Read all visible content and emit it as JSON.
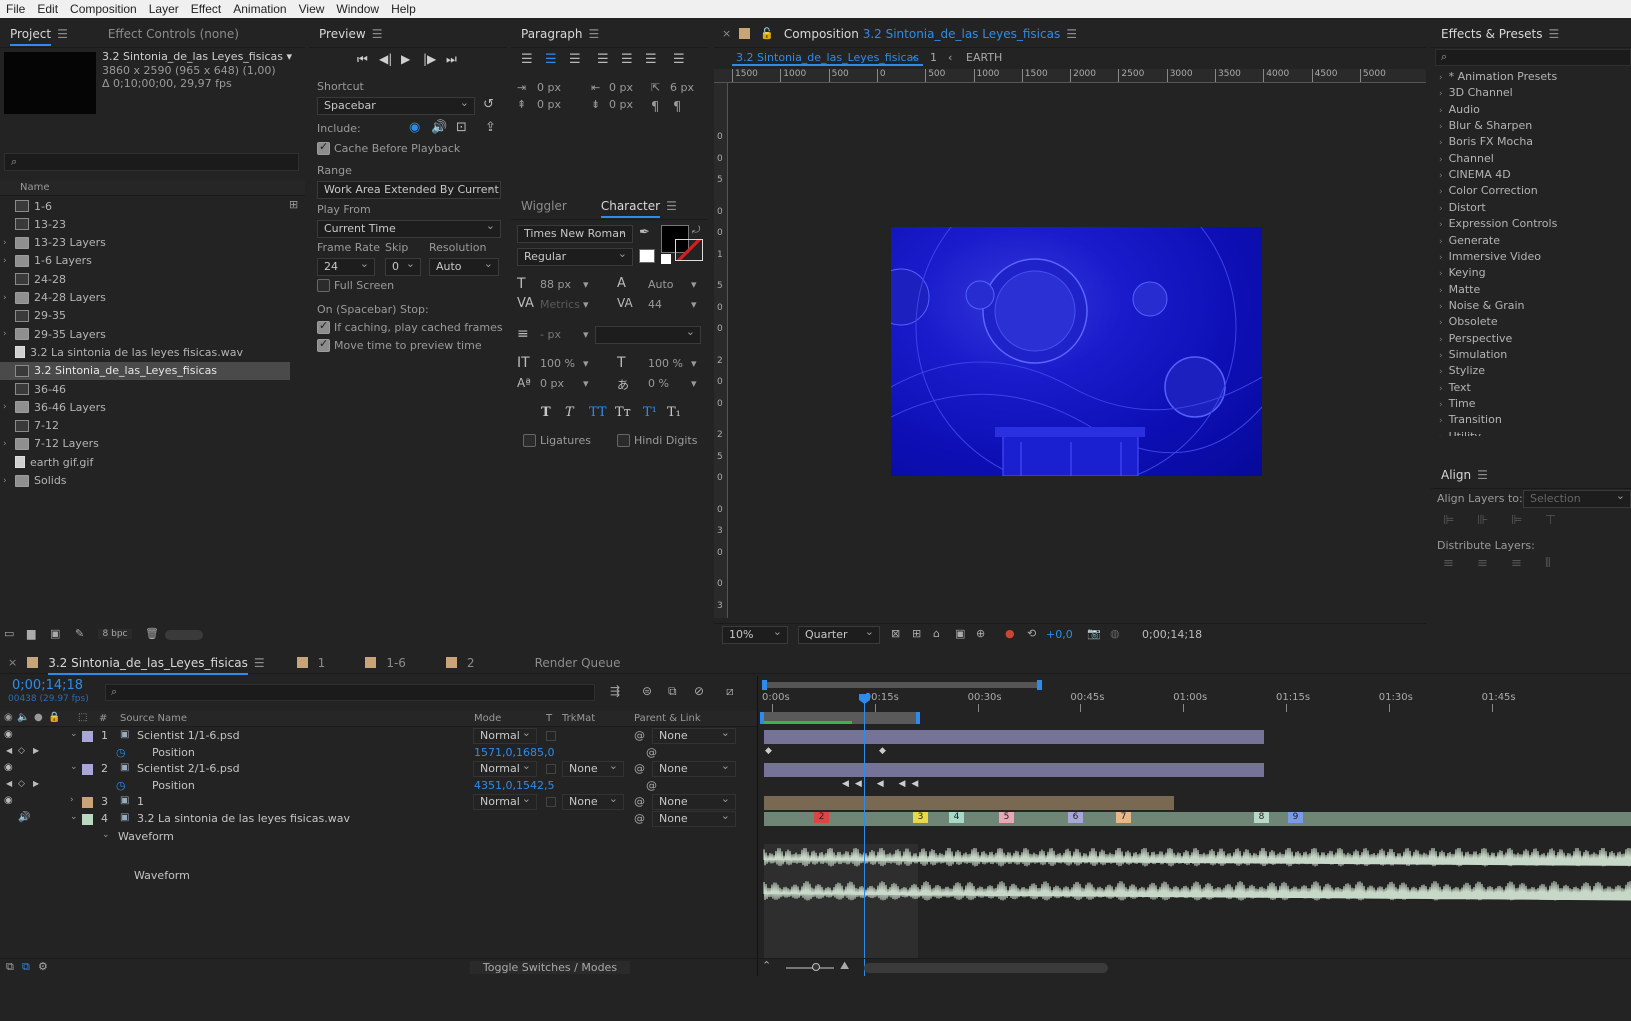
{
  "menu": [
    "File",
    "Edit",
    "Composition",
    "Layer",
    "Effect",
    "Animation",
    "View",
    "Window",
    "Help"
  ],
  "project": {
    "tab_label": "Project",
    "effect_controls_tab": "Effect Controls (none)",
    "selected_name": "3.2 Sintonia_de_las Leyes_fisicas",
    "selected_dims": "3860 x 2590  (965 x 648) (1,00)",
    "selected_dur": "Δ 0;10;00;00, 29,97 fps",
    "col_name": "Name",
    "bpc": "8 bpc",
    "items": [
      {
        "name": "1-6",
        "type": "comp",
        "twirl": false
      },
      {
        "name": "13-23",
        "type": "comp",
        "twirl": false
      },
      {
        "name": "13-23 Layers",
        "type": "folder",
        "twirl": true
      },
      {
        "name": "1-6 Layers",
        "type": "folder",
        "twirl": true
      },
      {
        "name": "24-28",
        "type": "comp",
        "twirl": false
      },
      {
        "name": "24-28 Layers",
        "type": "folder",
        "twirl": true
      },
      {
        "name": "29-35",
        "type": "comp",
        "twirl": false
      },
      {
        "name": "29-35 Layers",
        "type": "folder",
        "twirl": true
      },
      {
        "name": "3.2 La sintonia de las leyes fisicas.wav",
        "type": "file",
        "twirl": false
      },
      {
        "name": "3.2 Sintonia_de_las_Leyes_fisicas",
        "type": "comp",
        "twirl": false,
        "selected": true
      },
      {
        "name": "36-46",
        "type": "comp",
        "twirl": false
      },
      {
        "name": "36-46 Layers",
        "type": "folder",
        "twirl": true
      },
      {
        "name": "7-12",
        "type": "comp",
        "twirl": false
      },
      {
        "name": "7-12 Layers",
        "type": "folder",
        "twirl": true
      },
      {
        "name": "earth gif.gif",
        "type": "file",
        "twirl": false
      },
      {
        "name": "Solids",
        "type": "folder",
        "twirl": true
      }
    ]
  },
  "preview": {
    "tab_label": "Preview",
    "shortcut_label": "Shortcut",
    "shortcut_value": "Spacebar",
    "include_label": "Include:",
    "cache_label": "Cache Before Playback",
    "range_label": "Range",
    "range_value": "Work Area Extended By Current...",
    "play_from_label": "Play From",
    "play_from_value": "Current Time",
    "frame_rate_label": "Frame Rate",
    "skip_label": "Skip",
    "resolution_label": "Resolution",
    "frame_rate_value": "24",
    "skip_value": "0",
    "resolution_value": "Auto",
    "full_screen_label": "Full Screen",
    "stop_label": "On (Spacebar) Stop:",
    "if_caching_label": "If caching, play cached frames",
    "move_time_label": "Move time to preview time"
  },
  "paragraph": {
    "tab_label": "Paragraph",
    "indent_values": [
      "0 px",
      "0 px",
      "6 px",
      "0 px",
      "0 px"
    ]
  },
  "character": {
    "wiggler_tab": "Wiggler",
    "tab_label": "Character",
    "font": "Times New Roman",
    "style": "Regular",
    "size": "88 px",
    "leading": "Auto",
    "kerning": "Metrics",
    "tracking": "44",
    "stroke": "- px",
    "vscale": "100 %",
    "hscale": "100 %",
    "baseline": "0 px",
    "tsume": "0 %",
    "ligatures_label": "Ligatures",
    "hindi_label": "Hindi Digits",
    "style_buttons": [
      "T",
      "T",
      "TT",
      "Tт",
      "T¹",
      "T₁"
    ]
  },
  "composition": {
    "tab_prefix": "Composition",
    "tab_name": "3.2 Sintonia_de_las Leyes_fisicas",
    "breadcrumb_active": "3.2 Sintonia_de_las_Leyes_fisicas",
    "breadcrumb_1": "1",
    "breadcrumb_earth": "EARTH",
    "ruler_labels": [
      "1500",
      "1000",
      "500",
      "0",
      "500",
      "1000",
      "1500",
      "2000",
      "2500",
      "3000",
      "3500",
      "4000",
      "4500",
      "5000"
    ],
    "vruler_labels": [
      "0",
      "0",
      "5",
      "0",
      "0",
      "1",
      "5",
      "0",
      "0",
      "2",
      "0",
      "0",
      "2",
      "5",
      "0",
      "0",
      "3",
      "0",
      "0",
      "3",
      "5"
    ],
    "zoom": "10%",
    "quality": "Quarter",
    "exposure": "+0,0",
    "timecode": "0;00;14;18"
  },
  "effects": {
    "tab_label": "Effects & Presets",
    "items": [
      "* Animation Presets",
      "3D Channel",
      "Audio",
      "Blur & Sharpen",
      "Boris FX Mocha",
      "Channel",
      "CINEMA 4D",
      "Color Correction",
      "Distort",
      "Expression Controls",
      "Generate",
      "Immersive Video",
      "Keying",
      "Matte",
      "Noise & Grain",
      "Obsolete",
      "Perspective",
      "Simulation",
      "Stylize",
      "Text",
      "Time",
      "Transition",
      "Utility"
    ]
  },
  "align": {
    "tab_label": "Align",
    "align_to_label": "Align Layers to:",
    "align_to_value": "Selection",
    "distribute_label": "Distribute Layers:"
  },
  "timeline": {
    "tab_name": "3.2 Sintonia_de_las_Leyes_fisicas",
    "other_tabs": [
      "1",
      "1-6",
      "2"
    ],
    "render_queue": "Render Queue",
    "timecode": "0;00;14;18",
    "frame_info": "00438 (29.97 fps)",
    "col_source": "Source Name",
    "col_mode": "Mode",
    "col_t": "T",
    "col_trkmat": "TrkMat",
    "col_parent": "Parent & Link",
    "time_labels": [
      "0:00s",
      "00:15s",
      "00:30s",
      "00:45s",
      "01:00s",
      "01:15s",
      "01:30s",
      "01:45s"
    ],
    "toggle_label": "Toggle Switches / Modes",
    "layers": [
      {
        "num": "1",
        "name": "Scientist 1/1-6.psd",
        "mode": "Normal",
        "trkmat": "",
        "parent": "None",
        "color": "#a9a6d8",
        "position": "1571,0,1685,0"
      },
      {
        "num": "2",
        "name": "Scientist 2/1-6.psd",
        "mode": "Normal",
        "trkmat": "None",
        "parent": "None",
        "color": "#a9a6d8",
        "position": "4351,0,1542,5"
      },
      {
        "num": "3",
        "name": "1",
        "mode": "Normal",
        "trkmat": "None",
        "parent": "None",
        "color": "#c8a478"
      },
      {
        "num": "4",
        "name": "3.2 La sintonia de las leyes fisicas.wav",
        "mode": "",
        "trkmat": "",
        "parent": "None",
        "color": "#b8d8c0"
      }
    ],
    "position_label": "Position",
    "waveform_label": "Waveform",
    "markers": [
      "2",
      "3",
      "4",
      "5",
      "6",
      "7",
      "8",
      "9"
    ]
  }
}
